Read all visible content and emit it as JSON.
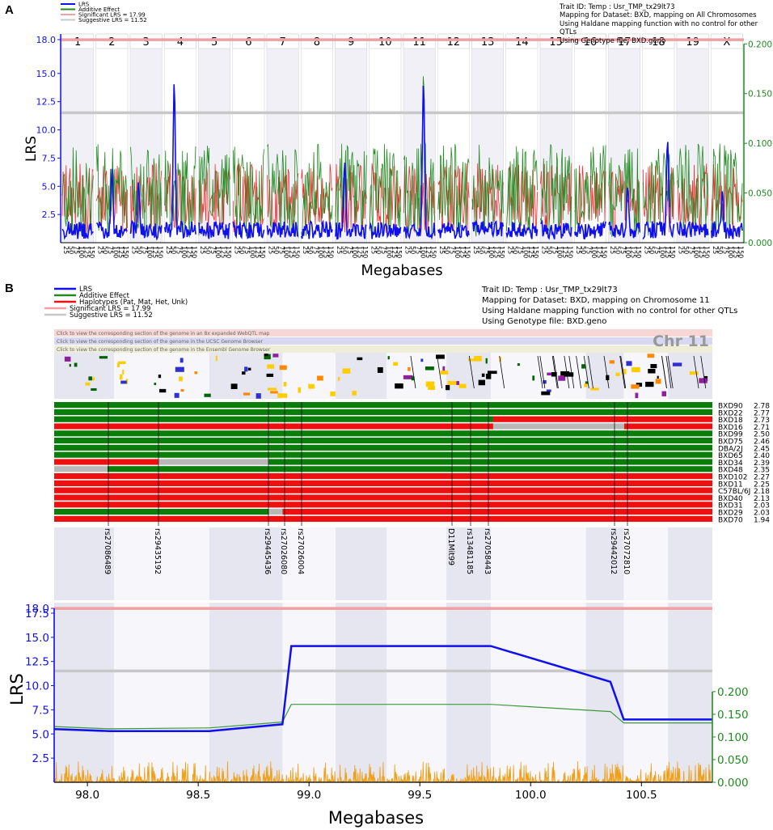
{
  "panel_a": {
    "letter": "A",
    "legend": [
      {
        "label": "LRS",
        "color": "#1010ee"
      },
      {
        "label": "Additive Effect",
        "color": "#228b22"
      },
      {
        "label": "Significant LRS = 17.99",
        "color": "#f0a0a0"
      },
      {
        "label": "Suggestive LRS = 11.52",
        "color": "#c8c8c8"
      }
    ],
    "info_lines": [
      "Trait ID: Temp : Usr_TMP_tx29lt73",
      "Mapping for Dataset: BXD, mapping on All Chromosomes",
      "Using Haldane mapping function with no control for other QTLs",
      "Using Genotype file: BXD.geno"
    ],
    "ylabel": "LRS",
    "xlabel": "Megabases",
    "y_ticks": [
      "18.0",
      "15.0",
      "12.5",
      "10.0",
      "7.5",
      "5.0",
      "2.5"
    ],
    "y2_ticks": [
      "0.200",
      "0.150",
      "0.100",
      "0.050",
      "0.000"
    ],
    "chromosomes": [
      "1",
      "2",
      "3",
      "4",
      "5",
      "6",
      "7",
      "8",
      "9",
      "10",
      "11",
      "12",
      "13",
      "14",
      "15",
      "16",
      "17",
      "18",
      "19",
      "X"
    ]
  },
  "panel_b": {
    "letter": "B",
    "legend": [
      {
        "label": "LRS",
        "color": "#1010ee"
      },
      {
        "label": "Additive Effect",
        "color": "#228b22"
      },
      {
        "label": "Haplotypes (Pat, Mat, Het, Unk)",
        "color": "#ee1010"
      },
      {
        "label": "Significant LRS = 17.99",
        "color": "#f0a0a0"
      },
      {
        "label": "Suggestive LRS = 11.52",
        "color": "#c8c8c8"
      }
    ],
    "info_lines": [
      "Trait ID: Temp : Usr_TMP_tx29lt73",
      "Mapping for Dataset: BXD, mapping on Chromosome 11",
      "Using Haldane mapping function with no control for other QTLs",
      "Using Genotype file: BXD.geno"
    ],
    "banners": [
      "Click to view the corresponding section of the genome in an 8x expanded WebQTL map",
      "Click to view the corresponding section of the genome in the UCSC Genome Browser",
      "Click to view the corresponding section of the genome in the Ensembl Genome Browser"
    ],
    "chr_label": "Chr 11",
    "strains": [
      {
        "name": "BXD90",
        "value": "2.78"
      },
      {
        "name": "BXD22",
        "value": "2.77"
      },
      {
        "name": "BXD18",
        "value": "2.73"
      },
      {
        "name": "BXD16",
        "value": "2.71"
      },
      {
        "name": "BXD99",
        "value": "2.50"
      },
      {
        "name": "BXD75",
        "value": "2.46"
      },
      {
        "name": "DBA/2J",
        "value": "2.45"
      },
      {
        "name": "BXD65",
        "value": "2.40"
      },
      {
        "name": "BXD34",
        "value": "2.39"
      },
      {
        "name": "BXD48",
        "value": "2.35"
      },
      {
        "name": "BXD102",
        "value": "2.27"
      },
      {
        "name": "BXD11",
        "value": "2.25"
      },
      {
        "name": "C57BL/6J",
        "value": "2.18"
      },
      {
        "name": "BXD40",
        "value": "2.13"
      },
      {
        "name": "BXD31",
        "value": "2.03"
      },
      {
        "name": "BXD29",
        "value": "2.03"
      },
      {
        "name": "BXD70",
        "value": "1.94"
      }
    ],
    "markers": [
      "rs27086489",
      "rs29435192",
      "rs29445436",
      "rs27026080",
      "rs27026004",
      "D11Mit99",
      "rs13481185",
      "rs27058443",
      "rs29442012",
      "rs27072810"
    ],
    "ylabel": "LRS",
    "xlabel": "Megabases",
    "y_ticks": [
      "18.0",
      "17.5",
      "15.0",
      "12.5",
      "10.0",
      "7.5",
      "5.0",
      "2.5"
    ],
    "y2_ticks": [
      "0.200",
      "0.150",
      "0.100",
      "0.050",
      "0.000"
    ]
  },
  "chart_data": [
    {
      "type": "line",
      "title": "",
      "xlabel": "Megabases",
      "ylabel": "LRS",
      "ylim": [
        0,
        18.5
      ],
      "y2lim": [
        0,
        0.21
      ],
      "grid": false,
      "legend_position": "top-left",
      "series": [
        {
          "name": "LRS",
          "color": "#1010ee",
          "peaks": [
            {
              "chromosome": "2",
              "lrs": 6.4
            },
            {
              "chromosome": "3",
              "lrs": 5.3
            },
            {
              "chromosome": "4",
              "lrs": 14.1
            },
            {
              "chromosome": "9",
              "lrs": 7.0
            },
            {
              "chromosome": "11",
              "lrs": 14.1
            },
            {
              "chromosome": "17",
              "lrs": 5.0
            },
            {
              "chromosome": "18",
              "lrs": 9.0
            },
            {
              "chromosome": "X",
              "lrs": 4.0
            }
          ]
        },
        {
          "name": "Additive Effect",
          "color": "#228b22",
          "peaks": [
            {
              "chromosome": "11",
              "effect": 0.17
            }
          ]
        }
      ],
      "thresholds": [
        {
          "name": "Significant LRS",
          "value": 17.99,
          "color": "#f0a0a0"
        },
        {
          "name": "Suggestive LRS",
          "value": 11.52,
          "color": "#c8c8c8"
        }
      ]
    },
    {
      "type": "line",
      "title": "",
      "xlabel": "Megabases",
      "ylabel": "LRS",
      "xlim": [
        97.85,
        100.82
      ],
      "ylim": [
        0,
        18.0
      ],
      "y2lim": [
        0,
        0.2
      ],
      "x_ticks": [
        98.0,
        98.5,
        99.0,
        99.5,
        100.0,
        100.5
      ],
      "grid": false,
      "legend_position": "top-left",
      "series": [
        {
          "name": "LRS",
          "color": "#1010ee",
          "x": [
            97.85,
            98.1,
            98.55,
            98.88,
            98.92,
            99.82,
            100.36,
            100.42,
            100.82
          ],
          "y": [
            5.5,
            5.3,
            5.3,
            6.0,
            14.1,
            14.1,
            10.4,
            6.5,
            6.5
          ]
        },
        {
          "name": "Additive Effect",
          "color": "#228b22",
          "x": [
            97.85,
            98.1,
            98.55,
            98.88,
            98.92,
            99.82,
            100.36,
            100.42,
            100.82
          ],
          "y": [
            0.123,
            0.118,
            0.12,
            0.133,
            0.172,
            0.172,
            0.156,
            0.131,
            0.131
          ]
        }
      ],
      "thresholds": [
        {
          "name": "Significant LRS",
          "value": 17.99,
          "color": "#f0a0a0"
        },
        {
          "name": "Suggestive LRS",
          "value": 11.52,
          "color": "#c8c8c8"
        }
      ]
    }
  ]
}
